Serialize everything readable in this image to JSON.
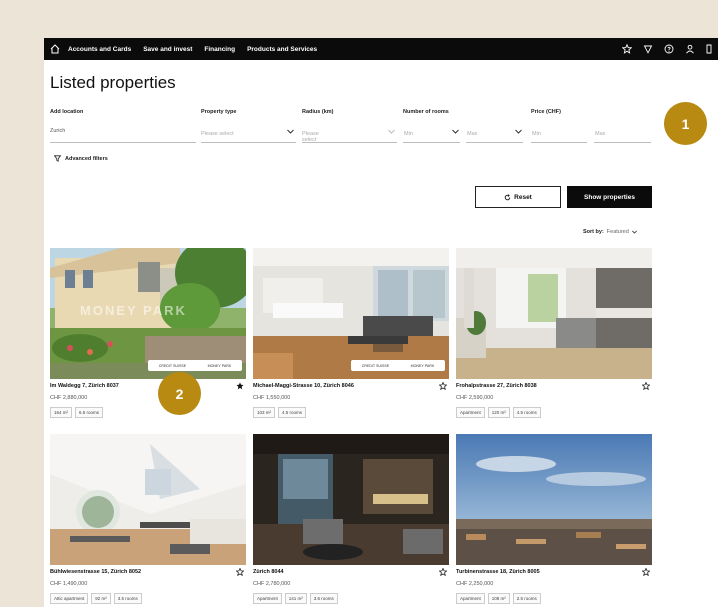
{
  "nav": {
    "items": [
      "Accounts and Cards",
      "Save and invest",
      "Financing",
      "Products and Services"
    ],
    "icons": [
      "star-icon",
      "heart-icon",
      "help-icon",
      "user-icon",
      "logout-icon"
    ]
  },
  "page": {
    "title": "Listed properties"
  },
  "filters": {
    "location": {
      "label": "Add location",
      "value": "Zurich"
    },
    "property_type": {
      "label": "Property type",
      "placeholder": "Please select"
    },
    "radius": {
      "label": "Radius (km)",
      "placeholder": "Please select"
    },
    "rooms": {
      "label": "Number of rooms",
      "min": "Min",
      "max": "Max"
    },
    "price": {
      "label": "Price (CHF)",
      "min": "Min",
      "max": "Max"
    },
    "advanced": "Advanced filters"
  },
  "actions": {
    "reset": "Reset",
    "show": "Show properties"
  },
  "sort": {
    "label": "Sort by:",
    "value": "Featured"
  },
  "listings": [
    {
      "address": "Im Waldegg 7, Zürich 8037",
      "price": "CHF 2,880,000",
      "tags": [
        "164 m²",
        "6.5 rooms"
      ],
      "favorite": true,
      "watermark": "MONEY PARK",
      "strip": [
        "CREDIT SUISSE",
        "MONEY PARK"
      ]
    },
    {
      "address": "Michael-Maggi-Strasse 10, Zürich 8046",
      "price": "CHF 1,550,000",
      "tags": [
        "103 m²",
        "4.5 rooms"
      ],
      "favorite": false,
      "strip": [
        "CREDIT SUISSE",
        "MONEY PARK"
      ]
    },
    {
      "address": "Frohalpstrasse 27, Zürich 8038",
      "price": "CHF 2,590,000",
      "tags": [
        "Apartment",
        "120 m²",
        "4.5 rooms"
      ],
      "favorite": false
    },
    {
      "address": "Bühlwiesenstrasse 15, Zürich 8052",
      "price": "CHF 1,490,000",
      "tags": [
        "Attic apartment",
        "92 m²",
        "3.5 rooms"
      ],
      "favorite": false
    },
    {
      "address": "Zürich 8044",
      "price": "CHF 2,780,000",
      "tags": [
        "Apartment",
        "141 m²",
        "3.5 rooms"
      ],
      "favorite": false
    },
    {
      "address": "Turbinenstrasse 18, Zürich 8005",
      "price": "CHF 2,250,000",
      "tags": [
        "Apartment",
        "108 m²",
        "2.5 rooms"
      ],
      "favorite": false
    }
  ],
  "annotations": [
    "1",
    "2"
  ],
  "colors": {
    "accent": "#b88a12",
    "nav_bg": "#0b0b0b",
    "background": "#ece4d6"
  }
}
